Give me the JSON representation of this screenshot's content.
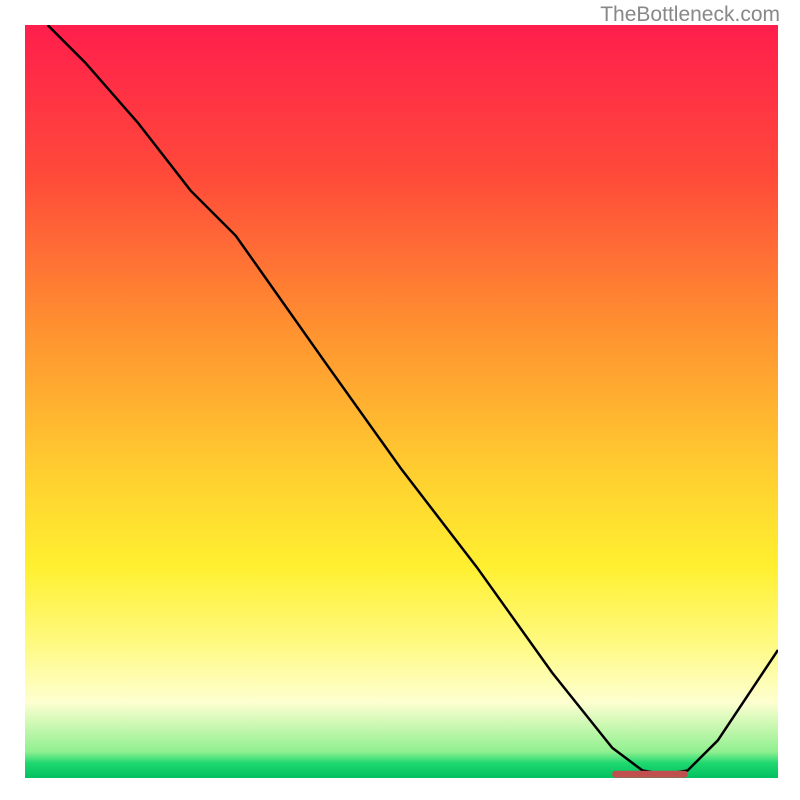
{
  "watermark": "TheBottleneck.com",
  "chart_data": {
    "type": "line",
    "title": "",
    "xlabel": "",
    "ylabel": "",
    "xlim": [
      0,
      100
    ],
    "ylim": [
      0,
      100
    ],
    "gradient_stops": [
      {
        "offset": 0,
        "color": "#ff1e4c"
      },
      {
        "offset": 20,
        "color": "#ff4a3a"
      },
      {
        "offset": 40,
        "color": "#ff9030"
      },
      {
        "offset": 60,
        "color": "#ffd030"
      },
      {
        "offset": 72,
        "color": "#fff030"
      },
      {
        "offset": 82,
        "color": "#fffa80"
      },
      {
        "offset": 90,
        "color": "#fdffd0"
      },
      {
        "offset": 96.5,
        "color": "#90f090"
      },
      {
        "offset": 98,
        "color": "#20d870"
      },
      {
        "offset": 100,
        "color": "#00c060"
      }
    ],
    "curve": {
      "x": [
        3,
        8,
        15,
        22,
        28,
        40,
        50,
        60,
        70,
        78,
        82,
        85,
        88,
        92,
        100
      ],
      "y": [
        100,
        95,
        87,
        78,
        72,
        55,
        41,
        28,
        14,
        4,
        1,
        0.5,
        1,
        5,
        17
      ]
    },
    "marker_bar": {
      "x_start": 78,
      "x_end": 88,
      "y": 0.5,
      "color": "#c05050"
    }
  }
}
